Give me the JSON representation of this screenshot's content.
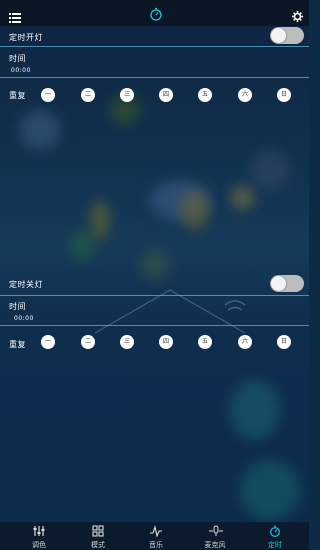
{
  "header": {
    "menu_icon": "list-icon",
    "center_icon": "timer-icon",
    "settings_icon": "gear-icon"
  },
  "on_timer": {
    "title": "定时开灯",
    "time_label": "时间",
    "time_value": "00:00",
    "repeat_label": "重复",
    "enabled": false
  },
  "off_timer": {
    "title": "定时关灯",
    "time_label": "时间",
    "time_value": "00:00",
    "repeat_label": "重复",
    "enabled": false
  },
  "days": [
    "一",
    "二",
    "三",
    "四",
    "五",
    "六",
    "日"
  ],
  "nav": {
    "items": [
      {
        "label": "调色",
        "icon": "sliders-icon"
      },
      {
        "label": "模式",
        "icon": "grid-icon"
      },
      {
        "label": "音乐",
        "icon": "music-wave-icon"
      },
      {
        "label": "麦克风",
        "icon": "microphone-wave-icon"
      },
      {
        "label": "定时",
        "icon": "timer-icon"
      }
    ],
    "active": "定时"
  },
  "colors": {
    "accent": "#26c6da",
    "divider": "#5aa9c9"
  }
}
